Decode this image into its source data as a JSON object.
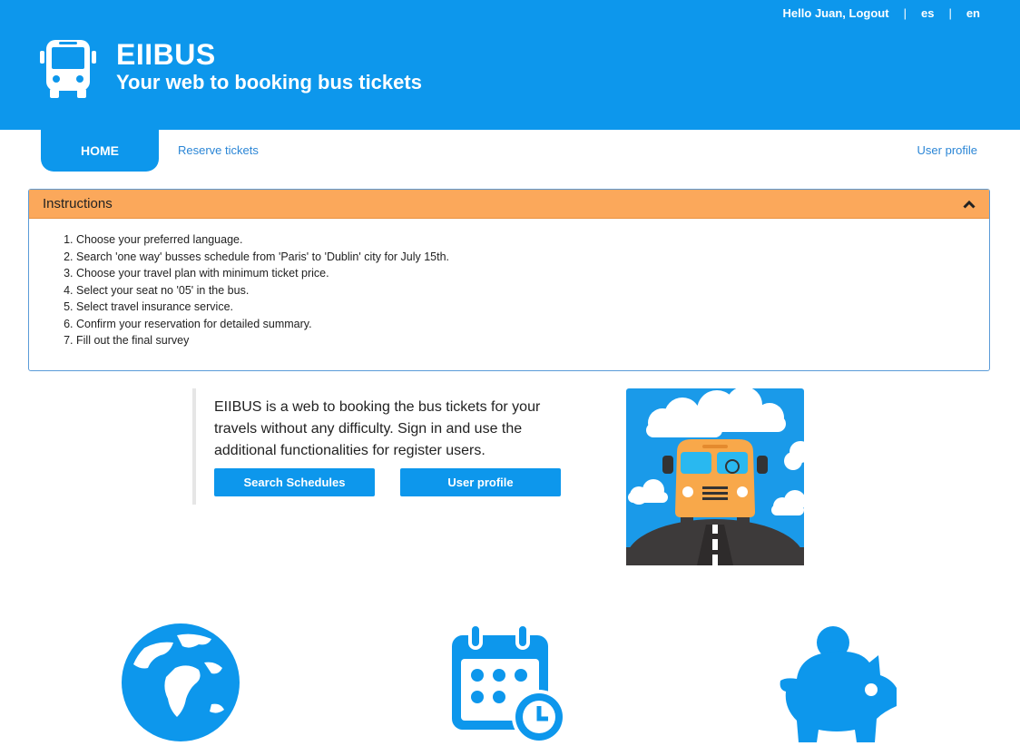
{
  "topbar": {
    "greeting": "Hello Juan,",
    "logout": "Logout",
    "sep1": "|",
    "lang_es": "es",
    "sep2": "|",
    "lang_en": "en"
  },
  "brand": {
    "title": "EIIBUS",
    "subtitle": "Your web to booking bus tickets",
    "icon": "bus-icon"
  },
  "nav": {
    "home": "HOME",
    "reserve": "Reserve tickets",
    "profile": "User profile"
  },
  "instructions": {
    "title": "Instructions",
    "toggle_icon": "chevron-up-icon",
    "items": [
      "Choose your preferred language.",
      "Search 'one way' busses schedule from 'Paris' to 'Dublin' city for July 15th.",
      "Choose your travel plan with minimum ticket price.",
      "Select your seat no '05' in the bus.",
      "Select travel insurance service.",
      "Confirm your reservation for detailed summary.",
      "Fill out the final survey"
    ]
  },
  "promo": {
    "text": "EIIBUS is a web to booking the bus tickets for your travels without any difficulty. Sign in and use the additional functionalities for register users.",
    "search_button": "Search Schedules",
    "profile_button": "User profile"
  },
  "features": {
    "icons": [
      "globe-icon",
      "calendar-clock-icon",
      "piggy-bank-icon"
    ]
  },
  "colors": {
    "primary": "#0d97ec",
    "panel_header": "#fba85b",
    "link": "#2b86d6"
  }
}
